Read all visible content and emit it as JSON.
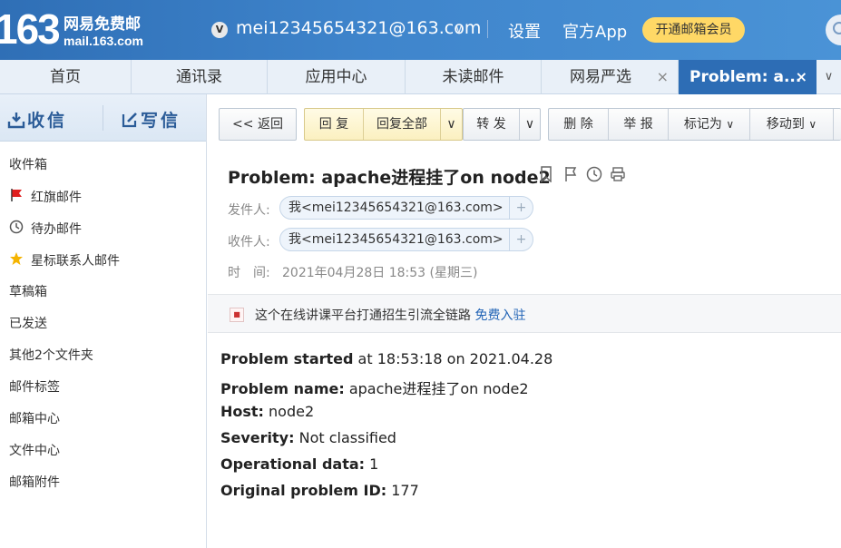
{
  "header": {
    "logo_number": "163",
    "logo_cn": "网易免费邮",
    "logo_domain": "mail.163.com",
    "vip_badge": "V",
    "account": "mei12345654321@163.com",
    "settings": "设置",
    "official_app": "官方App",
    "member_button": "开通邮箱会员"
  },
  "tabs": [
    {
      "label": "首页"
    },
    {
      "label": "通讯录"
    },
    {
      "label": "应用中心"
    },
    {
      "label": "未读邮件"
    },
    {
      "label": "网易严选"
    },
    {
      "label": "Problem: a..."
    }
  ],
  "sidebar": {
    "receive": "收信",
    "write": "写信",
    "items": [
      {
        "label": "收件箱"
      },
      {
        "label": "红旗邮件"
      },
      {
        "label": "待办邮件"
      },
      {
        "label": "星标联系人邮件"
      },
      {
        "label": "草稿箱"
      },
      {
        "label": "已发送"
      },
      {
        "label": "其他2个文件夹"
      },
      {
        "label": "邮件标签"
      },
      {
        "label": "邮箱中心"
      },
      {
        "label": "文件中心"
      },
      {
        "label": "邮箱附件"
      }
    ]
  },
  "toolbar": {
    "back": "<< 返回",
    "reply": "回 复",
    "reply_all": "回复全部",
    "forward": "转 发",
    "delete": "删 除",
    "report": "举 报",
    "mark_as": "标记为",
    "move_to": "移动到"
  },
  "mail": {
    "subject": "Problem: apache进程挂了on node2",
    "from_label": "发件人:",
    "from_value": "我<mei12345654321@163.com>",
    "to_label": "收件人:",
    "to_value": "我<mei12345654321@163.com>",
    "time_label": "时　间:",
    "time_value": "2021年04月28日 18:53 (星期三)",
    "ad_text": "这个在线讲课平台打通招生引流全链路",
    "ad_link": "免费入驻",
    "body": [
      {
        "key": "Problem started",
        "value": " at 18:53:18 on 2021.04.28"
      },
      {
        "key": "Problem name:",
        "value": " apache进程挂了on node2"
      },
      {
        "key": "Host:",
        "value": " node2"
      },
      {
        "key": "Severity:",
        "value": " Not classified"
      },
      {
        "key": "Operational data:",
        "value": " 1"
      },
      {
        "key": "Original problem ID:",
        "value": " 177"
      }
    ]
  },
  "colors": {
    "header_blue": "#3f85cc",
    "active_tab": "#2d6db5",
    "member_yellow": "#ffd866",
    "link_blue": "#2264b6"
  }
}
